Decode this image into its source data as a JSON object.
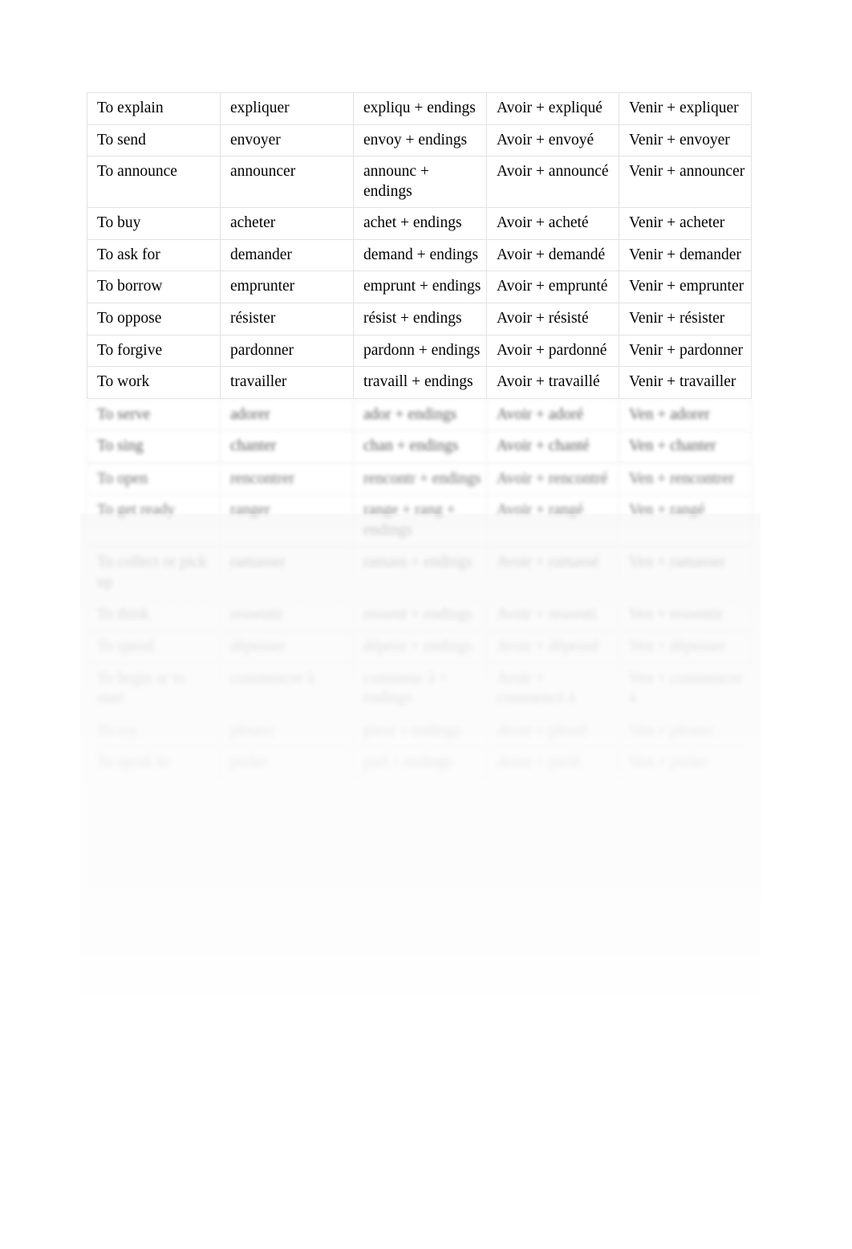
{
  "document": {
    "type": "verb-conjugation-table",
    "language_pair": "English-French",
    "page_background": "#ffffff",
    "text_color": "#000000",
    "border_color": "#e2e2e2"
  },
  "table": {
    "column_count": 5,
    "columns": [
      "english-infinitive",
      "french-infinitive",
      "stem-plus-endings",
      "avoir-perfect",
      "venir-recent-past"
    ],
    "rows": [
      {
        "english": "To explain",
        "french": "expliquer",
        "stem": "expliqu + endings",
        "avoir": "Avoir + expliqué",
        "venir": "Venir + expliquer"
      },
      {
        "english": "To send",
        "french": "envoyer",
        "stem": "envoy + endings",
        "avoir": "Avoir + envoyé",
        "venir": "Venir + envoyer"
      },
      {
        "english": "To announce",
        "french": "announcer",
        "stem": "announc + endings",
        "avoir": "Avoir + announcé",
        "venir": "Venir + announcer"
      },
      {
        "english": "To buy",
        "french": "acheter",
        "stem": "achet + endings",
        "avoir": "Avoir + acheté",
        "venir": "Venir + acheter"
      },
      {
        "english": "To ask for",
        "french": "demander",
        "stem": "demand + endings",
        "avoir": "Avoir + demandé",
        "venir": "Venir + demander"
      },
      {
        "english": "To borrow",
        "french": "emprunter",
        "stem": "emprunt + endings",
        "avoir": "Avoir + emprunté",
        "venir": "Venir + emprunter"
      },
      {
        "english": "To oppose",
        "french": "résister",
        "stem": "résist + endings",
        "avoir": "Avoir + résisté",
        "venir": "Venir + résister"
      },
      {
        "english": "To forgive",
        "french": "pardonner",
        "stem": "pardonn + endings",
        "avoir": "Avoir + pardonné",
        "venir": "Venir + pardonner"
      },
      {
        "english": "To work",
        "french": "travailler",
        "stem": "travaill + endings",
        "avoir": "Avoir + travaillé",
        "venir": "Venir + travailler"
      }
    ],
    "degraded_rows_note": "Rows below 'To work' are blurred and illegible in the source image.",
    "degraded_rows": [
      {
        "english": "",
        "french": "",
        "stem": "",
        "avoir": "",
        "venir": ""
      },
      {
        "english": "",
        "french": "",
        "stem": "",
        "avoir": "",
        "venir": ""
      },
      {
        "english": "",
        "french": "",
        "stem": "",
        "avoir": "",
        "venir": ""
      },
      {
        "english": "",
        "french": "",
        "stem": "",
        "avoir": "",
        "venir": ""
      },
      {
        "english": "",
        "french": "",
        "stem": "",
        "avoir": "",
        "venir": ""
      },
      {
        "english": "",
        "french": "",
        "stem": "",
        "avoir": "",
        "venir": ""
      },
      {
        "english": "",
        "french": "",
        "stem": "",
        "avoir": "",
        "venir": ""
      },
      {
        "english": "",
        "french": "",
        "stem": "",
        "avoir": "",
        "venir": ""
      },
      {
        "english": "",
        "french": "",
        "stem": "",
        "avoir": "",
        "venir": ""
      },
      {
        "english": "",
        "french": "",
        "stem": "",
        "avoir": "",
        "venir": ""
      }
    ]
  }
}
